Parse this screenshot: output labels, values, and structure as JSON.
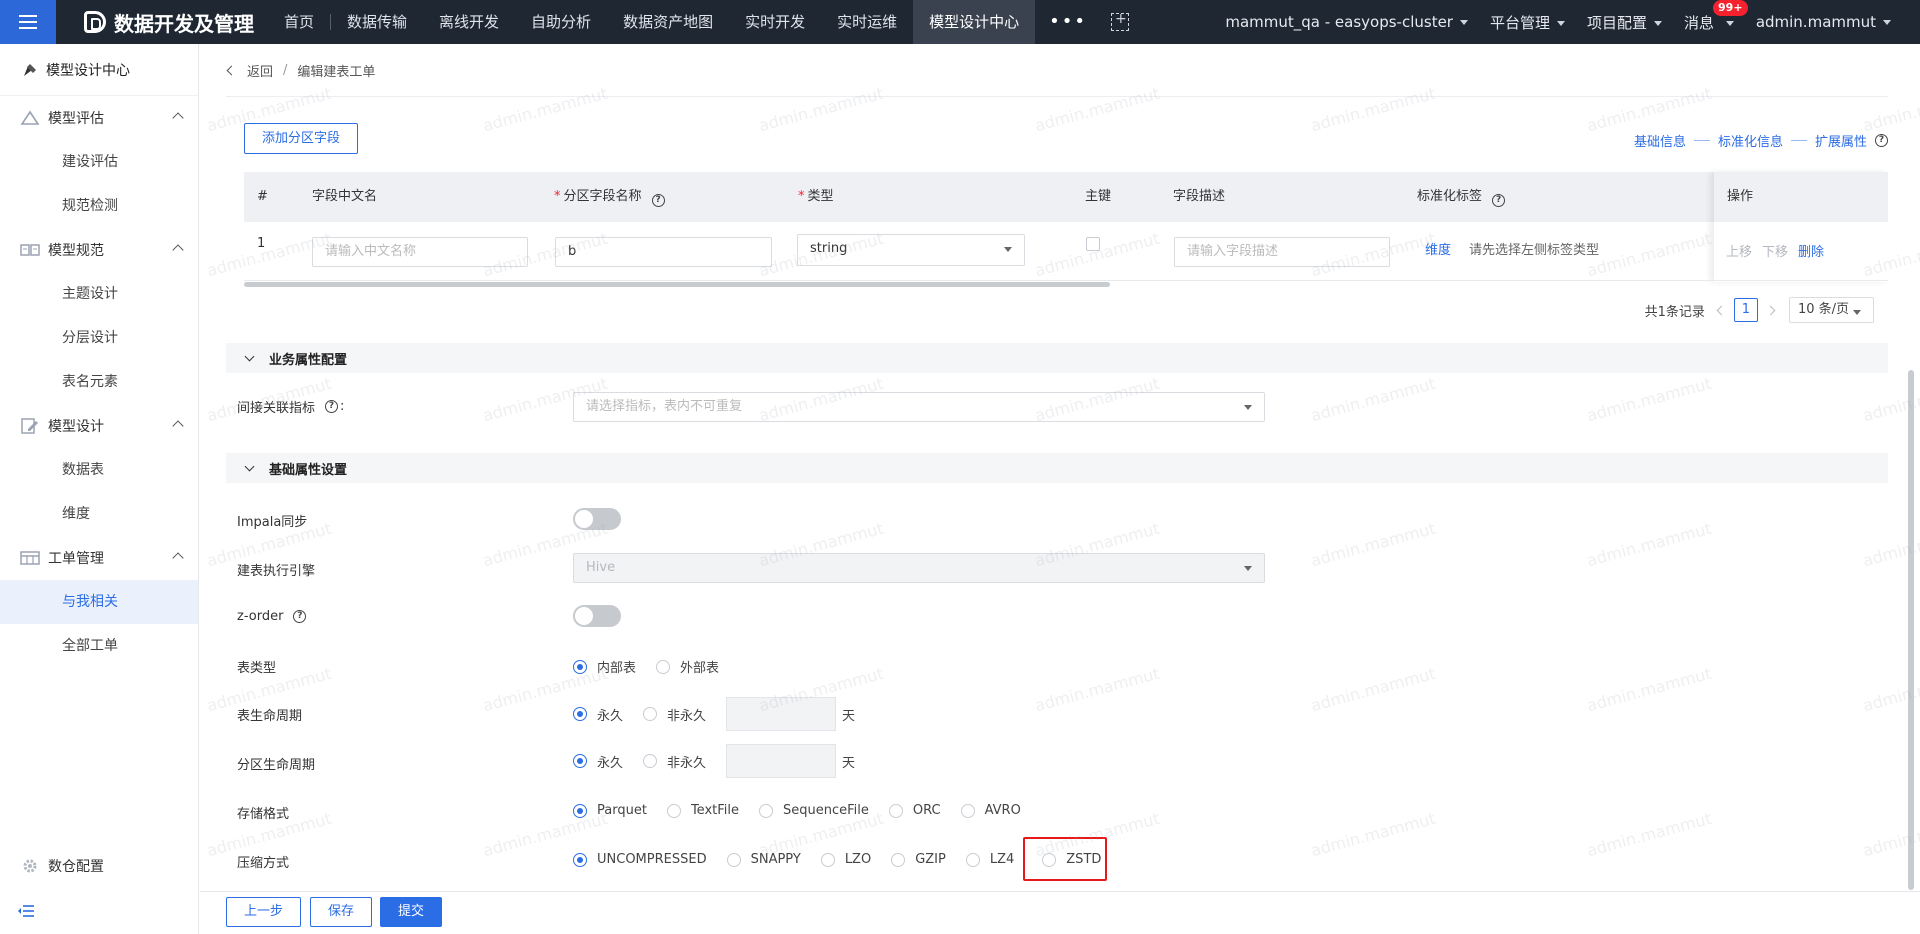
{
  "topbar": {
    "title": "数据开发及管理",
    "nav": [
      "首页",
      "数据传输",
      "离线开发",
      "自助分析",
      "数据资产地图",
      "实时开发",
      "实时运维",
      "模型设计中心"
    ],
    "more": "•••",
    "cluster": "mammut_qa - easyops-cluster",
    "platform": "平台管理",
    "project": "项目配置",
    "messages": "消息",
    "badge": "99+",
    "user": "admin.mammut",
    "colors": {
      "bar": "#1f2733",
      "accent": "#2d68d8"
    }
  },
  "sidebar": {
    "header": "模型设计中心",
    "groups": [
      {
        "label": "模型评估",
        "items": [
          "建设评估",
          "规范检测"
        ]
      },
      {
        "label": "模型规范",
        "items": [
          "主题设计",
          "分层设计",
          "表名元素"
        ]
      },
      {
        "label": "模型设计",
        "items": [
          "数据表",
          "维度"
        ]
      },
      {
        "label": "工单管理",
        "items": [
          "与我相关",
          "全部工单"
        ]
      }
    ],
    "bottom": "数仓配置"
  },
  "breadcrumb": {
    "back": "返回",
    "sep": "/",
    "current": "编辑建表工单"
  },
  "partition": {
    "add_button": "添加分区字段",
    "steps": [
      "基础信息",
      "标准化信息",
      "扩展属性"
    ],
    "columns": {
      "index": "#",
      "cn_name": "字段中文名",
      "part_name": "分区字段名称",
      "type": "类型",
      "pk": "主键",
      "desc": "字段描述",
      "tag": "标准化标签",
      "ops": "操作"
    },
    "row": {
      "index": "1",
      "cn_placeholder": "请输入中文名称",
      "name_value": "b",
      "type_value": "string",
      "desc_placeholder": "请输入字段描述",
      "tag_link": "维度",
      "tag_hint": "请先选择左侧标签类型",
      "op_up": "上移",
      "op_down": "下移",
      "op_delete": "删除"
    },
    "pager": {
      "total": "共1条记录",
      "current": "1",
      "size": "10 条/页"
    }
  },
  "business": {
    "section": "业务属性配置",
    "indicator_label": "间接关联指标",
    "indicator_colon": ":",
    "indicator_placeholder": "请选择指标，表内不可重复"
  },
  "basic": {
    "section": "基础属性设置",
    "impala_label": "Impala同步",
    "impala_on": false,
    "engine_label": "建表执行引擎",
    "engine_value": "Hive",
    "zorder_label": "z-order",
    "zorder_on": false,
    "table_type_label": "表类型",
    "table_type_options": [
      "内部表",
      "外部表"
    ],
    "table_type_selected": "内部表",
    "table_life_label": "表生命周期",
    "life_options": [
      "永久",
      "非永久"
    ],
    "life_selected": "永久",
    "day_unit": "天",
    "partition_life_label": "分区生命周期",
    "storage_label": "存储格式",
    "storage_options": [
      "Parquet",
      "TextFile",
      "SequenceFile",
      "ORC",
      "AVRO"
    ],
    "storage_selected": "Parquet",
    "compress_label": "压缩方式",
    "compress_options": [
      "UNCOMPRESSED",
      "SNAPPY",
      "LZO",
      "GZIP",
      "LZ4",
      "ZSTD"
    ],
    "compress_selected": "UNCOMPRESSED"
  },
  "footer": {
    "prev": "上一步",
    "save": "保存",
    "submit": "提交"
  },
  "watermark": "admin.mammut"
}
